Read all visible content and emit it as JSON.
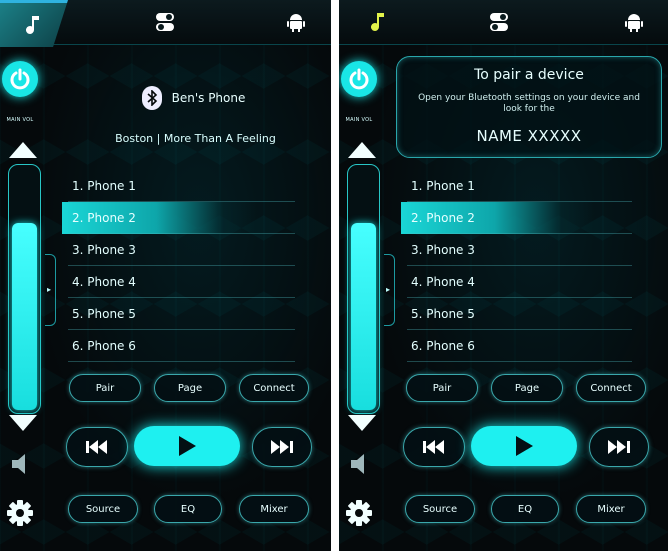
{
  "screens": [
    {
      "tabs": [
        {
          "icon": "music-note-icon",
          "active": true
        },
        {
          "icon": "toggle-switches-icon",
          "active": false
        },
        {
          "icon": "android-icon",
          "active": false
        }
      ],
      "volume": {
        "label": "MAIN VOL",
        "level": 0.78
      },
      "header": {
        "device_name": "Ben's Phone",
        "icon": "bluetooth-icon"
      },
      "now_playing": "Boston | More Than A Feeling",
      "devices": [
        "1. Phone 1",
        "2. Phone 2",
        "3. Phone 3",
        "4. Phone 4",
        "5. Phone 5",
        "6. Phone 6"
      ],
      "selected_device_index": 1,
      "actions": {
        "pair": "Pair",
        "page": "Page",
        "connect": "Connect"
      },
      "bottom": {
        "source": "Source",
        "eq": "EQ",
        "mixer": "Mixer"
      }
    },
    {
      "tabs": [
        {
          "icon": "music-note-icon",
          "active": false
        },
        {
          "icon": "toggle-switches-icon",
          "active": false
        },
        {
          "icon": "android-icon",
          "active": false
        }
      ],
      "volume": {
        "label": "MAIN VOL",
        "level": 0.78
      },
      "pair_prompt": {
        "title": "To pair a device",
        "body": "Open your Bluetooth settings on your device and look for the",
        "name": "NAME XXXXX"
      },
      "devices": [
        "1. Phone 1",
        "2. Phone 2",
        "3. Phone 3",
        "4. Phone 4",
        "5. Phone 5",
        "6. Phone 6"
      ],
      "selected_device_index": 1,
      "actions": {
        "pair": "Pair",
        "page": "Page",
        "connect": "Connect"
      },
      "bottom": {
        "source": "Source",
        "eq": "EQ",
        "mixer": "Mixer"
      }
    }
  ],
  "colors": {
    "accent": "#19e6e6",
    "background": "#05090b",
    "border": "#3aa7ab"
  }
}
